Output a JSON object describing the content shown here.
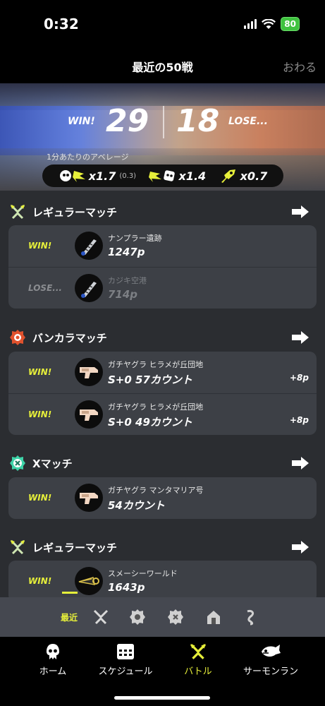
{
  "status": {
    "time": "0:32",
    "battery": "80"
  },
  "header": {
    "title": "最近の50戦",
    "close_label": "おわる"
  },
  "summary": {
    "win_label": "WIN!",
    "wins": "29",
    "losses": "18",
    "lose_label": "LOSE...",
    "average_label": "1分あたりのアベレージ",
    "kills": "x1.7",
    "assists": "(0.3)",
    "deaths": "x1.4",
    "specials": "x0.7"
  },
  "sections": [
    {
      "title": "レギュラーマッチ",
      "icon": "regular-match-icon",
      "battles": [
        {
          "result": "WIN!",
          "stage": "ナンプラー遺跡",
          "detail": "1247p"
        },
        {
          "result": "LOSE...",
          "stage": "カジキ空港",
          "detail": "714p"
        }
      ]
    },
    {
      "title": "バンカラマッチ",
      "icon": "bankara-match-icon",
      "battles": [
        {
          "result": "WIN!",
          "stage": "ガチヤグラ ヒラメが丘団地",
          "detail": "S+0 57カウント",
          "delta": "+8p"
        },
        {
          "result": "WIN!",
          "stage": "ガチヤグラ ヒラメが丘団地",
          "detail": "S+0 49カウント",
          "delta": "+8p"
        }
      ]
    },
    {
      "title": "Xマッチ",
      "icon": "x-match-icon",
      "battles": [
        {
          "result": "WIN!",
          "stage": "ガチヤグラ マンタマリア号",
          "detail": "54カウント"
        }
      ]
    },
    {
      "title": "レギュラーマッチ",
      "icon": "regular-match-icon",
      "battles": [
        {
          "result": "WIN!",
          "stage": "スメーシーワールド",
          "detail": "1643p"
        }
      ]
    }
  ],
  "filter": {
    "active_label": "最近"
  },
  "tabs": [
    {
      "label": "ホーム",
      "icon": "squid-icon"
    },
    {
      "label": "スケジュール",
      "icon": "calendar-icon"
    },
    {
      "label": "バトル",
      "icon": "crossed-weapons-icon"
    },
    {
      "label": "サーモンラン",
      "icon": "salmon-icon"
    }
  ],
  "colors": {
    "accent": "#e6ef3a",
    "card": "#3d4046",
    "background": "#2b2d31",
    "bankara": "#e0522e",
    "xmatch": "#3ed3a8"
  }
}
